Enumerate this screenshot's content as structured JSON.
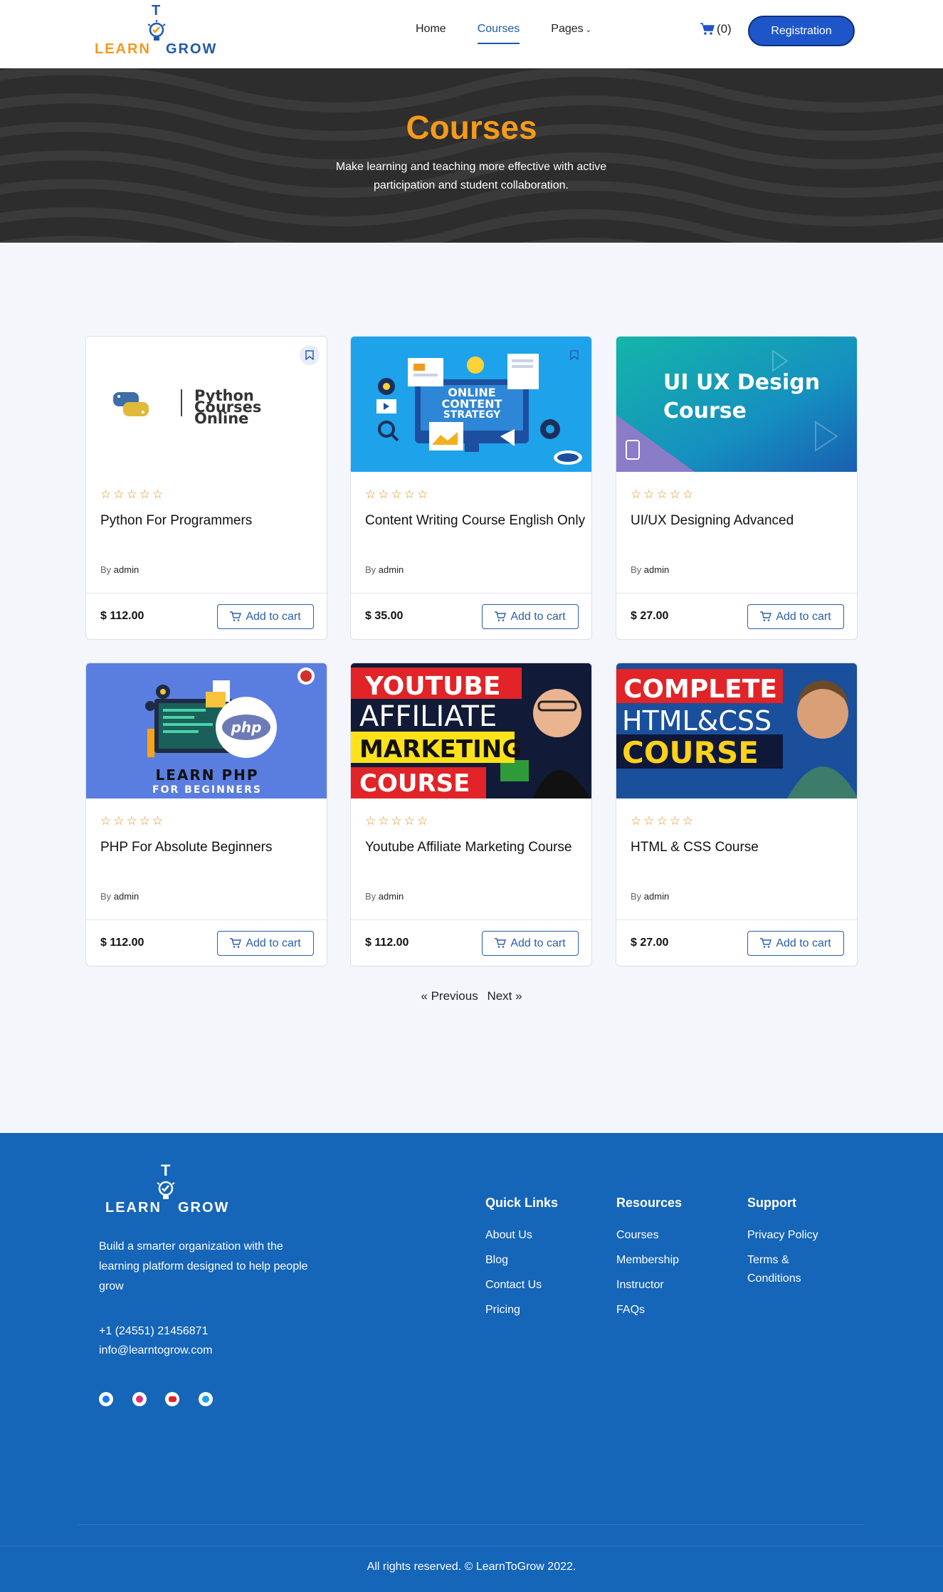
{
  "brand": {
    "logo_top": "T",
    "logo_left": "LEARN",
    "logo_right": "GROW"
  },
  "nav": {
    "items": [
      {
        "label": "Home"
      },
      {
        "label": "Courses"
      },
      {
        "label": "Pages"
      }
    ],
    "active": "Courses",
    "cart_count": "(0)",
    "registration_label": "Registration"
  },
  "hero": {
    "title": "Courses",
    "subtitle": "Make learning and teaching more effective with active participation and student collaboration."
  },
  "courses": [
    {
      "title": "Python For Programmers",
      "stars": "☆☆☆☆☆",
      "by_label": "By",
      "author": "admin",
      "price": "$ 112.00",
      "cart_label": "Add to cart",
      "image_text": [
        "Python",
        "Courses",
        "Online"
      ]
    },
    {
      "title": "Content Writing Course English Only",
      "stars": "☆☆☆☆☆",
      "by_label": "By",
      "author": "admin",
      "price": "$ 35.00",
      "cart_label": "Add to cart",
      "image_text": [
        "ONLINE",
        "CONTENT",
        "STRATEGY"
      ]
    },
    {
      "title": "UI/UX Designing Advanced",
      "stars": "☆☆☆☆☆",
      "by_label": "By",
      "author": "admin",
      "price": "$ 27.00",
      "cart_label": "Add to cart",
      "image_text": [
        "UI UX Design",
        "Course"
      ]
    },
    {
      "title": "PHP For Absolute Beginners",
      "stars": "☆☆☆☆☆",
      "by_label": "By",
      "author": "admin",
      "price": "$ 112.00",
      "cart_label": "Add to cart",
      "image_text": [
        "php",
        "LEARN PHP",
        "FOR BEGINNERS"
      ]
    },
    {
      "title": "Youtube Affiliate Marketing Course",
      "stars": "☆☆☆☆☆",
      "by_label": "By",
      "author": "admin",
      "price": "$ 112.00",
      "cart_label": "Add to cart",
      "image_text": [
        "YOUTUBE",
        "AFFILIATE",
        "MARKETING",
        "COURSE"
      ]
    },
    {
      "title": "HTML & CSS Course",
      "stars": "☆☆☆☆☆",
      "by_label": "By",
      "author": "admin",
      "price": "$ 27.00",
      "cart_label": "Add to cart",
      "image_text": [
        "COMPLETE",
        "HTML&CSS",
        "COURSE"
      ]
    }
  ],
  "pagination": {
    "previous": "« Previous",
    "next": "Next »"
  },
  "footer": {
    "tagline": "Build a smarter organization with the learning platform designed to help people grow",
    "phone": "+1 (24551) 21456871",
    "email": "info@learntogrow.com",
    "social": [
      "facebook",
      "instagram",
      "youtube",
      "twitter"
    ],
    "columns": [
      {
        "title": "Quick Links",
        "links": [
          "About Us",
          "Blog",
          "Contact Us",
          "Pricing"
        ]
      },
      {
        "title": "Resources",
        "links": [
          "Courses",
          "Membership",
          "Instructor",
          "FAQs"
        ]
      },
      {
        "title": "Support",
        "links": [
          "Privacy Policy",
          "Terms & Conditions"
        ]
      }
    ],
    "copyright": "All rights reserved. © LearnToGrow 2022."
  },
  "colors": {
    "accent": "#1e56c9",
    "hero_title": "#f59a1c",
    "footer_bg": "#1565b8",
    "star": "#e08a1a"
  }
}
